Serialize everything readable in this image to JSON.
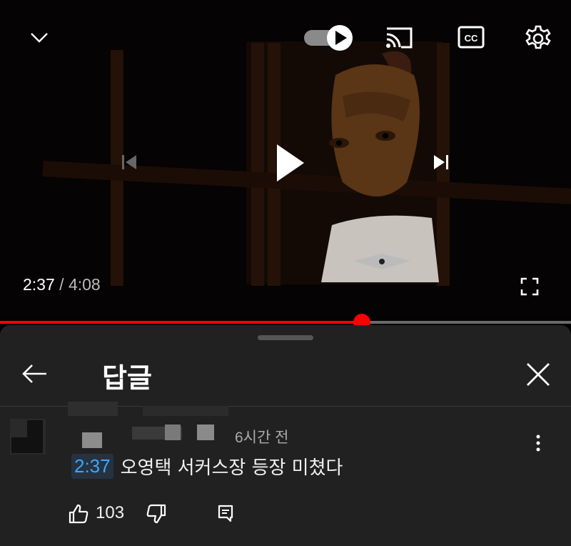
{
  "player": {
    "current_time": "2:37",
    "separator": "/",
    "duration": "4:08",
    "progress_fraction": 0.634,
    "autoplay_on": true,
    "accent_color": "#ff0000"
  },
  "icons": {
    "collapse": "chevron-down-icon",
    "autoplay": "autoplay-toggle-icon",
    "cast": "cast-icon",
    "captions": "captions-icon",
    "settings": "gear-icon",
    "previous": "skip-previous-icon",
    "play": "play-icon",
    "next": "skip-next-icon",
    "fullscreen": "fullscreen-icon",
    "back": "back-arrow-icon",
    "close": "close-icon",
    "more": "more-vert-icon",
    "like": "thumbs-up-icon",
    "dislike": "thumbs-down-icon",
    "reply": "reply-icon"
  },
  "captions_label": "CC",
  "replies_panel": {
    "title": "답글"
  },
  "comment": {
    "age": "6시간 전",
    "timestamp_link": "2:37",
    "text": "오영택 서커스장 등장 미쳤다",
    "like_count": "103",
    "link_color": "#3ea6ff"
  }
}
